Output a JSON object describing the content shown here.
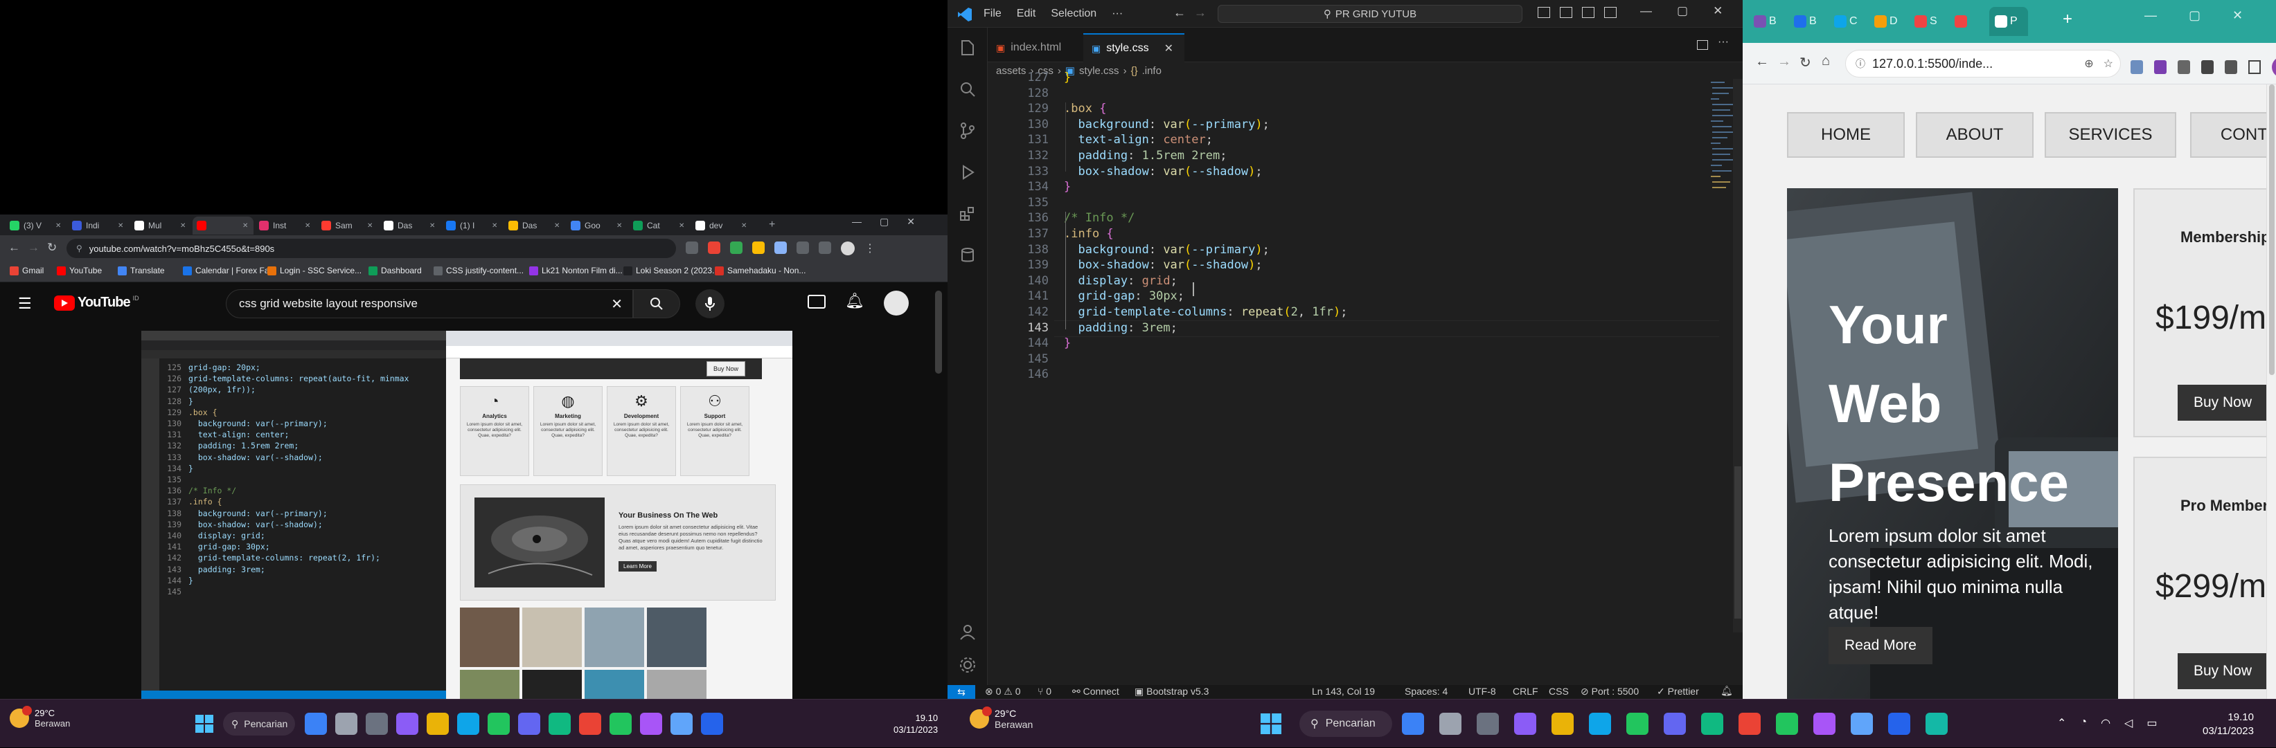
{
  "left_browser": {
    "tabs": [
      {
        "label": "(3) V",
        "color": "#25d366"
      },
      {
        "label": "Indi",
        "color": "#3b5bdb"
      },
      {
        "label": "Mul",
        "color": "#ffffff"
      },
      {
        "label": "",
        "color": "#ff0000",
        "active": true
      },
      {
        "label": "Inst",
        "color": "#e1306c"
      },
      {
        "label": "Sam",
        "color": "#ff3b30"
      },
      {
        "label": "Das",
        "color": "#ffffff"
      },
      {
        "label": "(1) I",
        "color": "#1877f2"
      },
      {
        "label": "Das",
        "color": "#fbbc04"
      },
      {
        "label": "Goo",
        "color": "#4285f4"
      },
      {
        "label": "Cat",
        "color": "#0f9d58"
      },
      {
        "label": "dev",
        "color": "#ffffff"
      }
    ],
    "url": "youtube.com/watch?v=moBhz5C455o&t=890s",
    "bookmarks": [
      "Gmail",
      "YouTube",
      "Translate",
      "Calendar | Forex Fa...",
      "Login - SSC Service...",
      "Dashboard",
      "CSS justify-content...",
      "Lk21 Nonton Film di...",
      "Loki Season 2 (2023...",
      "Samehadaku - Non..."
    ],
    "youtube": {
      "logo_text": "YouTube",
      "country": "ID",
      "search_value": "css grid website layout responsive"
    },
    "video_code": {
      "line_numbers": [
        "125",
        "126",
        "127",
        "128",
        "129",
        "130",
        "131",
        "132",
        "133",
        "134",
        "135",
        "136",
        "137",
        "138",
        "139",
        "140",
        "141",
        "142",
        "143",
        "144",
        "145"
      ],
      "lines": [
        "grid-gap: 20px;",
        "grid-template-columns: repeat(auto-fit, minmax",
        "(200px, 1fr));",
        "}",
        ".box {",
        "  background: var(--primary);",
        "  text-align: center;",
        "  padding: 1.5rem 2rem;",
        "  box-shadow: var(--shadow);",
        "}",
        "",
        "/* Info */",
        ".info {",
        "  background: var(--primary);",
        "  box-shadow: var(--shadow);",
        "  display: grid;",
        "  grid-gap: 30px;",
        "  grid-template-columns: repeat(2, 1fr);",
        "  padding: 3rem;",
        "}",
        ""
      ]
    },
    "video_page": {
      "buy_now": "Buy Now",
      "boxes": [
        {
          "title": "Analytics",
          "text": "Lorem ipsum dolor sit amet, consectetur adipisicing elit. Quae, expedita?"
        },
        {
          "title": "Marketing",
          "text": "Lorem ipsum dolor sit amet, consectetur adipisicing elit. Quae, expedita?"
        },
        {
          "title": "Development",
          "text": "Lorem ipsum dolor sit amet, consectetur adipisicing elit. Quae, expedita?"
        },
        {
          "title": "Support",
          "text": "Lorem ipsum dolor sit amet, consectetur adipisicing elit. Quae, expedita?"
        }
      ],
      "info_title": "Your Business On The Web",
      "info_text": "Lorem ipsum dolor sit amet consectetur adipisicing elit. Vitae eius recusandae deserunt possimus nemo non repellendus? Quas atque vero modi quidem! Autem cupiditate fugit distinctio ad amet, asperiores praesentium quo tenetur.",
      "learn_more": "Learn More"
    }
  },
  "vscode": {
    "menu": [
      "File",
      "Edit",
      "Selection",
      "···"
    ],
    "search": "PR GRID YUTUB",
    "tabs": [
      {
        "label": "index.html",
        "active": false
      },
      {
        "label": "style.css",
        "active": true
      }
    ],
    "breadcrumb": [
      "assets",
      "css",
      "style.css",
      ".info"
    ],
    "line_numbers": [
      "127",
      "128",
      "129",
      "130",
      "131",
      "132",
      "133",
      "134",
      "135",
      "136",
      "137",
      "138",
      "139",
      "140",
      "141",
      "142",
      "143",
      "144",
      "145",
      "146"
    ],
    "code": [
      [
        {
          "t": "}",
          "c": "#ffd700"
        }
      ],
      [],
      [
        {
          "t": ".box ",
          "c": "#d7ba7d"
        },
        {
          "t": "{",
          "c": "#da70d6"
        }
      ],
      [
        {
          "t": "  background",
          "c": "#9cdcfe"
        },
        {
          "t": ": ",
          "c": "#cccccc"
        },
        {
          "t": "var",
          "c": "#dcdcaa"
        },
        {
          "t": "(",
          "c": "#ffd700"
        },
        {
          "t": "--primary",
          "c": "#9cdcfe"
        },
        {
          "t": ")",
          "c": "#ffd700"
        },
        {
          "t": ";",
          "c": "#cccccc"
        }
      ],
      [
        {
          "t": "  text-align",
          "c": "#9cdcfe"
        },
        {
          "t": ": ",
          "c": "#cccccc"
        },
        {
          "t": "center",
          "c": "#ce9178"
        },
        {
          "t": ";",
          "c": "#cccccc"
        }
      ],
      [
        {
          "t": "  padding",
          "c": "#9cdcfe"
        },
        {
          "t": ": ",
          "c": "#cccccc"
        },
        {
          "t": "1.5rem 2rem",
          "c": "#b5cea8"
        },
        {
          "t": ";",
          "c": "#cccccc"
        }
      ],
      [
        {
          "t": "  box-shadow",
          "c": "#9cdcfe"
        },
        {
          "t": ": ",
          "c": "#cccccc"
        },
        {
          "t": "var",
          "c": "#dcdcaa"
        },
        {
          "t": "(",
          "c": "#ffd700"
        },
        {
          "t": "--shadow",
          "c": "#9cdcfe"
        },
        {
          "t": ")",
          "c": "#ffd700"
        },
        {
          "t": ";",
          "c": "#cccccc"
        }
      ],
      [
        {
          "t": "}",
          "c": "#da70d6"
        }
      ],
      [],
      [
        {
          "t": "/* Info */",
          "c": "#6a9955"
        }
      ],
      [
        {
          "t": ".info ",
          "c": "#d7ba7d"
        },
        {
          "t": "{",
          "c": "#da70d6"
        }
      ],
      [
        {
          "t": "  background",
          "c": "#9cdcfe"
        },
        {
          "t": ": ",
          "c": "#cccccc"
        },
        {
          "t": "var",
          "c": "#dcdcaa"
        },
        {
          "t": "(",
          "c": "#ffd700"
        },
        {
          "t": "--primary",
          "c": "#9cdcfe"
        },
        {
          "t": ")",
          "c": "#ffd700"
        },
        {
          "t": ";",
          "c": "#cccccc"
        }
      ],
      [
        {
          "t": "  box-shadow",
          "c": "#9cdcfe"
        },
        {
          "t": ": ",
          "c": "#cccccc"
        },
        {
          "t": "var",
          "c": "#dcdcaa"
        },
        {
          "t": "(",
          "c": "#ffd700"
        },
        {
          "t": "--shadow",
          "c": "#9cdcfe"
        },
        {
          "t": ")",
          "c": "#ffd700"
        },
        {
          "t": ";",
          "c": "#cccccc"
        }
      ],
      [
        {
          "t": "  display",
          "c": "#9cdcfe"
        },
        {
          "t": ": ",
          "c": "#cccccc"
        },
        {
          "t": "grid",
          "c": "#ce9178"
        },
        {
          "t": ";",
          "c": "#cccccc"
        }
      ],
      [
        {
          "t": "  grid-gap",
          "c": "#9cdcfe"
        },
        {
          "t": ": ",
          "c": "#cccccc"
        },
        {
          "t": "30px",
          "c": "#b5cea8"
        },
        {
          "t": ";",
          "c": "#cccccc"
        }
      ],
      [
        {
          "t": "  grid-template-columns",
          "c": "#9cdcfe"
        },
        {
          "t": ": ",
          "c": "#cccccc"
        },
        {
          "t": "repeat",
          "c": "#dcdcaa"
        },
        {
          "t": "(",
          "c": "#ffd700"
        },
        {
          "t": "2",
          "c": "#b5cea8"
        },
        {
          "t": ", ",
          "c": "#cccccc"
        },
        {
          "t": "1fr",
          "c": "#b5cea8"
        },
        {
          "t": ")",
          "c": "#ffd700"
        },
        {
          "t": ";",
          "c": "#cccccc"
        }
      ],
      [
        {
          "t": "  padding",
          "c": "#9cdcfe"
        },
        {
          "t": ": ",
          "c": "#cccccc"
        },
        {
          "t": "3rem",
          "c": "#b5cea8"
        },
        {
          "t": ";",
          "c": "#cccccc"
        }
      ],
      [
        {
          "t": "}",
          "c": "#da70d6"
        }
      ],
      [],
      []
    ],
    "active_line": "143",
    "status": {
      "problems": "⊗ 0 ⚠ 0",
      "ports": "⑂ 0",
      "connect": "Connect",
      "bootstrap": "Bootstrap v5.3",
      "cursor": "Ln 143, Col 19",
      "spaces": "Spaces: 4",
      "encoding": "UTF-8",
      "eol": "CRLF",
      "language": "CSS",
      "port": "Port : 5500",
      "prettier": "Prettier"
    }
  },
  "right_browser": {
    "tabs": [
      "B",
      "B",
      "C",
      "D",
      "S",
      "",
      "P"
    ],
    "url": "127.0.0.1:5500/inde...",
    "profile": "M",
    "nav": [
      "HOME",
      "ABOUT",
      "SERVICES",
      "CONTA"
    ],
    "hero": {
      "title_lines": [
        "Your",
        "Web",
        "Presence"
      ],
      "text": "Lorem ipsum dolor sit amet consectetur adipisicing elit. Modi, ipsam! Nihil quo minima nulla atque!",
      "button": "Read More"
    },
    "cards": [
      {
        "title": "Membership",
        "price": "$199/m",
        "button": "Buy Now"
      },
      {
        "title": "Pro Membersh",
        "price": "$299/m",
        "button": "Buy Now"
      }
    ]
  },
  "taskbar_left": {
    "weather_temp": "29°C",
    "weather_desc": "Berawan",
    "search": "Pencarian",
    "time": "19.10",
    "date": "03/11/2023"
  },
  "taskbar_right": {
    "weather_temp": "29°C",
    "weather_desc": "Berawan",
    "search": "Pencarian",
    "time": "19.10",
    "date": "03/11/2023"
  }
}
